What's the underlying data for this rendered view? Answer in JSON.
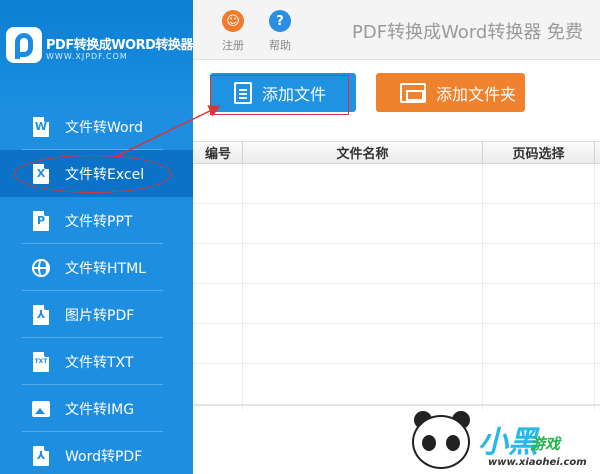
{
  "logo": {
    "title": "PDF转换成WORD转换器",
    "url": "WWW.XJPDF.COM"
  },
  "topbar": {
    "register_label": "注册",
    "help_label": "帮助",
    "title": "PDF转换成Word转换器 免费"
  },
  "sidebar": {
    "items": [
      {
        "label": "文件转Word",
        "icon": "word-doc-icon",
        "glyph": "W"
      },
      {
        "label": "文件转Excel",
        "icon": "excel-doc-icon",
        "glyph": "X"
      },
      {
        "label": "文件转PPT",
        "icon": "ppt-doc-icon",
        "glyph": "P"
      },
      {
        "label": "文件转HTML",
        "icon": "globe-icon",
        "glyph": ""
      },
      {
        "label": "图片转PDF",
        "icon": "pdf-doc-icon",
        "glyph": "⅄"
      },
      {
        "label": "文件转TXT",
        "icon": "txt-doc-icon",
        "glyph": "TXT"
      },
      {
        "label": "文件转IMG",
        "icon": "image-icon",
        "glyph": ""
      },
      {
        "label": "Word转PDF",
        "icon": "pdf-doc-icon",
        "glyph": "⅄"
      }
    ]
  },
  "toolbar": {
    "add_file_label": "添加文件",
    "add_folder_label": "添加文件夹"
  },
  "table": {
    "columns": [
      "编号",
      "文件名称",
      "页码选择"
    ]
  },
  "watermark": {
    "brand": "小黑",
    "suffix": "游戏",
    "url": "www.xiaohei.com"
  },
  "colors": {
    "sidebar": "#1e8fe0",
    "sidebar_active": "#0c72c7",
    "add_file": "#1f93e1",
    "add_folder": "#f0822e",
    "annotation": "#d83434",
    "register_icon": "#f07b2c",
    "help_icon": "#2a8fe3"
  }
}
